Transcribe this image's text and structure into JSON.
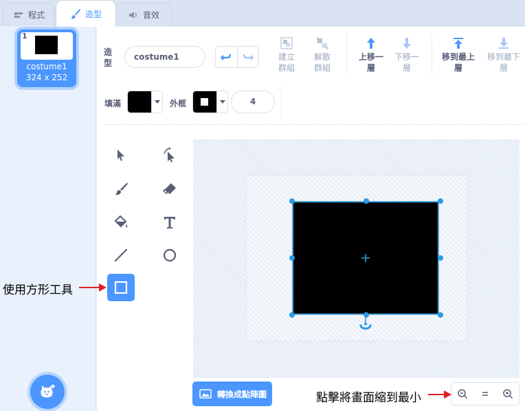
{
  "tabs": [
    {
      "label": "程式",
      "icon": "code-icon",
      "active": false
    },
    {
      "label": "造型",
      "icon": "brush-icon",
      "active": true
    },
    {
      "label": "音效",
      "icon": "sound-icon",
      "active": false
    }
  ],
  "costume_list": {
    "items": [
      {
        "number": "1",
        "name": "costume1",
        "size": "324 x 252",
        "selected": true
      }
    ],
    "add_button_icon": "choose-costume-icon"
  },
  "editor": {
    "name_label": "造型",
    "name_value": "costume1",
    "toolbar": {
      "group": "建立群組",
      "ungroup": "解散群組",
      "forward": "上移一層",
      "backward": "下移一層",
      "front": "移到最上層",
      "back": "移到最下層"
    },
    "fill_label": "填滿",
    "fill_color": "#000000",
    "outline_label": "外框",
    "outline_color": "#000000",
    "outline_width": "4",
    "convert_button": "轉換成點陣圖",
    "tools": [
      "select-icon",
      "reshape-icon",
      "brush-icon",
      "eraser-icon",
      "fill-icon",
      "text-icon",
      "line-icon",
      "circle-icon",
      "rectangle-icon"
    ],
    "active_tool": "rectangle-icon"
  },
  "annotations": {
    "rect_tool": "使用方形工具",
    "zoom_out": "點擊將畫面縮到最小"
  },
  "colors": {
    "accent": "#4c97ff",
    "annotation_arrow": "#e02020"
  }
}
